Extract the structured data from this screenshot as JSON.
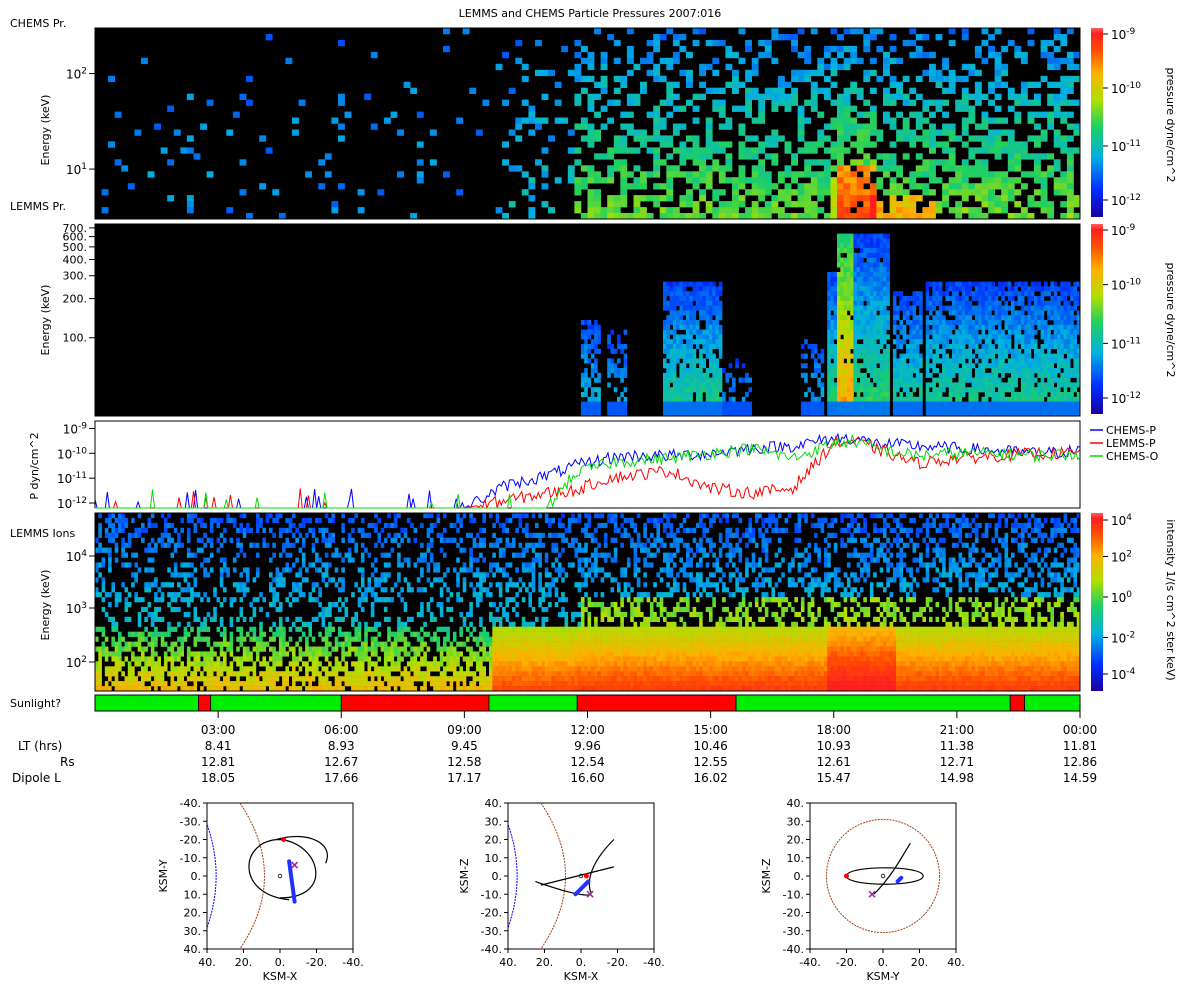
{
  "title": "LEMMS and CHEMS Particle Pressures  2007:016",
  "panels": {
    "chems": {
      "label_top": "CHEMS Pr.",
      "label_bottom": "LEMMS Pr.",
      "ylabel": "Energy (keV)",
      "yticks": [
        {
          "v": 10,
          "base": "10",
          "exp": "1"
        },
        {
          "v": 100,
          "base": "10",
          "exp": "2"
        }
      ],
      "ylim_log": [
        3,
        300
      ],
      "colorbar": {
        "label": "pressure dyne/cm^2",
        "ticks": [
          {
            "base": "10",
            "exp": "-9"
          },
          {
            "base": "10",
            "exp": "-10"
          },
          {
            "base": "10",
            "exp": "-11"
          },
          {
            "base": "10",
            "exp": "-12"
          }
        ]
      }
    },
    "lemms_pressure": {
      "ylabel": "Energy (keV)",
      "yticks": [
        "700.",
        "600.",
        "500.",
        "400.",
        "300.",
        "200.",
        "100."
      ],
      "ytick_values": [
        700,
        600,
        500,
        400,
        300,
        200,
        100
      ],
      "ylim_log": [
        25,
        750
      ],
      "colorbar": {
        "label": "pressure dyne/cm^2",
        "ticks": [
          {
            "base": "10",
            "exp": "-9"
          },
          {
            "base": "10",
            "exp": "-10"
          },
          {
            "base": "10",
            "exp": "-11"
          },
          {
            "base": "10",
            "exp": "-12"
          }
        ]
      }
    },
    "pressure_lines": {
      "ylabel": "P dyn/cm^2",
      "yticks": [
        {
          "base": "10",
          "exp": "-9"
        },
        {
          "base": "10",
          "exp": "-10"
        },
        {
          "base": "10",
          "exp": "-11"
        },
        {
          "base": "10",
          "exp": "-12"
        }
      ],
      "legend": [
        {
          "name": "CHEMS-P",
          "color": "#0000ff"
        },
        {
          "name": "LEMMS-P",
          "color": "#ff0000"
        },
        {
          "name": "CHEMS-O",
          "color": "#00dd00"
        }
      ]
    },
    "lemms_ions": {
      "label": "LEMMS Ions",
      "ylabel": "Energy (keV)",
      "yticks": [
        {
          "base": "10",
          "exp": "4"
        },
        {
          "base": "10",
          "exp": "3"
        },
        {
          "base": "10",
          "exp": "2"
        }
      ],
      "colorbar": {
        "label": "intensity 1/(s cm^2 ster keV)",
        "ticks": [
          {
            "base": "10",
            "exp": "4"
          },
          {
            "base": "10",
            "exp": "2"
          },
          {
            "base": "10",
            "exp": "0"
          },
          {
            "base": "10",
            "exp": "-2"
          },
          {
            "base": "10",
            "exp": "-4"
          }
        ]
      }
    },
    "sunlight": {
      "label": "Sunlight?",
      "segments": [
        {
          "from": 0.0,
          "to": 2.52,
          "lit": true
        },
        {
          "from": 2.52,
          "to": 2.82,
          "lit": false
        },
        {
          "from": 2.82,
          "to": 6.0,
          "lit": true
        },
        {
          "from": 6.0,
          "to": 9.6,
          "lit": false
        },
        {
          "from": 9.6,
          "to": 11.75,
          "lit": true
        },
        {
          "from": 11.75,
          "to": 15.62,
          "lit": false
        },
        {
          "from": 15.62,
          "to": 22.3,
          "lit": true
        },
        {
          "from": 22.3,
          "to": 22.65,
          "lit": false
        },
        {
          "from": 22.65,
          "to": 24.0,
          "lit": true
        }
      ],
      "colors": {
        "lit": "#00ee00",
        "dark": "#ff0000"
      }
    }
  },
  "time_axis": {
    "ticks": [
      "03:00",
      "06:00",
      "09:00",
      "12:00",
      "15:00",
      "18:00",
      "21:00",
      "00:00"
    ],
    "tick_hours": [
      3,
      6,
      9,
      12,
      15,
      18,
      21,
      24
    ],
    "rows": [
      {
        "label": "LT (hrs)",
        "values": [
          "8.41",
          "8.93",
          "9.45",
          "9.96",
          "10.46",
          "10.93",
          "11.38",
          "11.81"
        ]
      },
      {
        "label": "Rs",
        "values": [
          "12.81",
          "12.67",
          "12.58",
          "12.54",
          "12.55",
          "12.61",
          "12.71",
          "12.86"
        ]
      },
      {
        "label": "Dipole L",
        "values": [
          "18.05",
          "17.66",
          "17.17",
          "16.60",
          "16.02",
          "15.47",
          "14.98",
          "14.59"
        ]
      }
    ]
  },
  "orbits": [
    {
      "xlabel": "KSM-X",
      "ylabel": "KSM-Y",
      "xticks": [
        "40.",
        "20.",
        "0.",
        "-20.",
        "-40."
      ],
      "yticks": [
        "-40.",
        "-30.",
        "-20.",
        "-10.",
        "0.",
        "10.",
        "20.",
        "30.",
        "40."
      ]
    },
    {
      "xlabel": "KSM-X",
      "ylabel": "KSM-Z",
      "xticks": [
        "40.",
        "20.",
        "0.",
        "-20.",
        "-40."
      ],
      "yticks": [
        "40.",
        "30.",
        "20.",
        "10.",
        "0.",
        "-10.",
        "-20.",
        "-30.",
        "-40."
      ]
    },
    {
      "xlabel": "KSM-Y",
      "ylabel": "KSM-Z",
      "xticks": [
        "-40.",
        "-20.",
        "0.",
        "20.",
        "40."
      ],
      "yticks": [
        "40.",
        "30.",
        "20.",
        "10.",
        "0.",
        "-10.",
        "-20.",
        "-30.",
        "-40."
      ]
    }
  ],
  "chart_data": [
    {
      "type": "heatmap",
      "x_range_hours": [
        0,
        24
      ],
      "note_series": "CHEMS pressure spectrogram",
      "colorscale": "log pressure 1e-12 to 1e-9"
    },
    {
      "type": "heatmap",
      "x_range_hours": [
        0,
        24
      ],
      "colorscale": "log pressure 1e-12 to 1e-9"
    },
    {
      "type": "line",
      "x_range_hours": [
        0,
        24
      ],
      "ylim_exp": [
        -12.2,
        -8.7
      ],
      "series": [
        {
          "name": "CHEMS-P",
          "x": [
            0,
            2,
            4,
            6,
            8,
            9,
            10,
            11,
            11.7,
            12.5,
            13,
            14,
            15,
            16,
            17,
            18,
            18.5,
            19,
            20,
            21,
            22,
            23,
            24
          ],
          "y_exp": [
            -12.2,
            -12.2,
            -12.2,
            -12.2,
            -12.2,
            -12.2,
            -11.3,
            -10.9,
            -10.5,
            -10.2,
            -10.1,
            -10.1,
            -10.0,
            -9.8,
            -9.7,
            -9.4,
            -9.4,
            -9.6,
            -9.7,
            -9.8,
            -9.9,
            -10.0,
            -9.9
          ]
        },
        {
          "name": "LEMMS-P",
          "x": [
            0,
            2,
            4,
            6,
            8,
            9,
            10,
            11,
            11.7,
            12.5,
            13,
            14,
            15,
            16,
            17,
            18,
            18.5,
            19,
            20,
            21,
            22,
            23,
            24
          ],
          "y_exp": [
            -12.2,
            -12.2,
            -12.2,
            -12.2,
            -12.2,
            -12.2,
            -11.9,
            -11.6,
            -11.5,
            -11.0,
            -10.9,
            -10.7,
            -11.4,
            -11.6,
            -11.4,
            -9.6,
            -9.5,
            -9.8,
            -10.4,
            -10.2,
            -10.1,
            -10.0,
            -10.0
          ]
        },
        {
          "name": "CHEMS-O",
          "x": [
            0,
            2,
            4,
            6,
            8,
            9,
            10,
            11,
            11.7,
            12.5,
            13,
            14,
            15,
            16,
            17,
            18,
            18.5,
            19,
            20,
            21,
            22,
            23,
            24
          ],
          "y_exp": [
            -12.2,
            -12.2,
            -12.2,
            -12.2,
            -12.2,
            -12.2,
            -12.2,
            -12.2,
            -10.8,
            -10.4,
            -10.3,
            -10.2,
            -10.0,
            -9.8,
            -10.2,
            -9.6,
            -9.5,
            -9.8,
            -10.1,
            -10.0,
            -10.0,
            -10.1,
            -10.0
          ]
        }
      ]
    },
    {
      "type": "heatmap",
      "x_range_hours": [
        0,
        24
      ],
      "colorscale": "log intensity 1e-4 to 1e4"
    }
  ]
}
